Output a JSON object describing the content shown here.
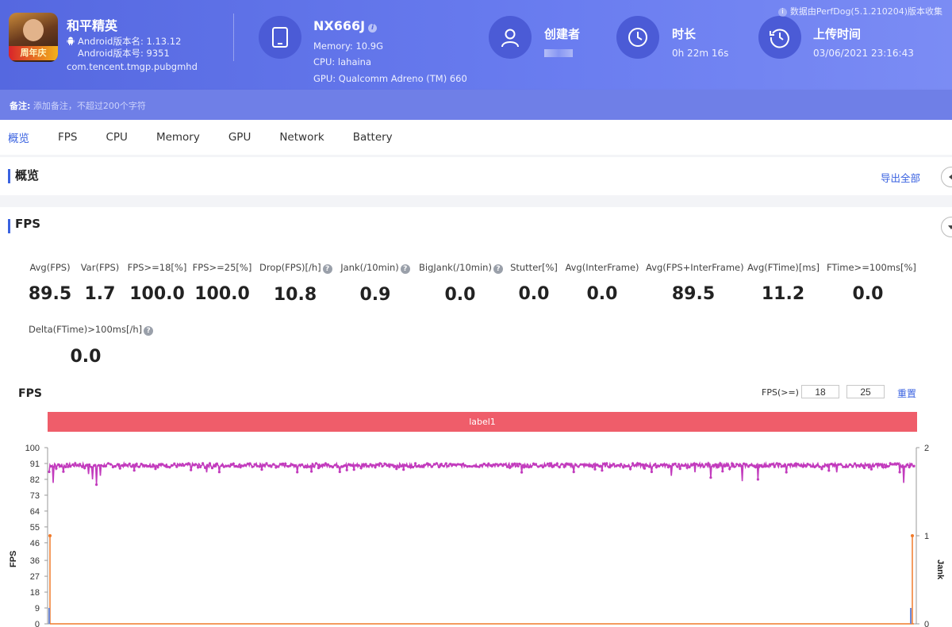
{
  "header": {
    "app_name": "和平精英",
    "app_icon_badge": "周年庆",
    "android_version_name": "Android版本名: 1.13.12",
    "android_version_code": "Android版本号: 9351",
    "package": "com.tencent.tmgp.pubgmhd",
    "device_name": "NX666J",
    "memory": "Memory: 10.9G",
    "cpu": "CPU: lahaina",
    "gpu": "GPU: Qualcomm Adreno (TM) 660",
    "creator_label": "创建者",
    "duration_label": "时长",
    "duration_value": "0h 22m 16s",
    "upload_label": "上传时间",
    "upload_value": "03/06/2021 23:16:43",
    "source_note": "数据由PerfDog(5.1.210204)版本收集"
  },
  "remark": {
    "label": "备注:",
    "placeholder": "添加备注，不超过200个字符"
  },
  "tabs": [
    "概览",
    "FPS",
    "CPU",
    "Memory",
    "GPU",
    "Network",
    "Battery"
  ],
  "overview": {
    "title": "概览",
    "export_label": "导出全部"
  },
  "fps_section": {
    "title": "FPS",
    "metrics": [
      {
        "label": "Avg(FPS)",
        "value": "89.5"
      },
      {
        "label": "Var(FPS)",
        "value": "1.7"
      },
      {
        "label": "FPS>=18[%]",
        "value": "100.0"
      },
      {
        "label": "FPS>=25[%]",
        "value": "100.0"
      },
      {
        "label": "Drop(FPS)[/h]",
        "value": "10.8"
      },
      {
        "label": "Jank(/10min)",
        "value": "0.9"
      },
      {
        "label": "BigJank(/10min)",
        "value": "0.0"
      },
      {
        "label": "Stutter[%]",
        "value": "0.0"
      },
      {
        "label": "Avg(InterFrame)",
        "value": "0.0"
      },
      {
        "label": "Avg(FPS+InterFrame)",
        "value": "89.5"
      },
      {
        "label": "Avg(FTime)[ms]",
        "value": "11.2"
      },
      {
        "label": "FTime>=100ms[%]",
        "value": "0.0"
      },
      {
        "label": "Delta(FTime)>100ms[/h]",
        "value": "0.0"
      }
    ],
    "chart_title": "FPS",
    "threshold_label": "FPS(>=)",
    "threshold_1": "18",
    "threshold_2": "25",
    "reset_label": "重置",
    "band_label": "label1"
  },
  "chart_data": {
    "type": "line",
    "title": "FPS",
    "ylabel": "FPS",
    "y2label": "Jank",
    "ylim": [
      0,
      100
    ],
    "y2lim": [
      0,
      2
    ],
    "yticks": [
      0,
      9,
      18,
      27,
      36,
      46,
      55,
      64,
      73,
      82,
      91,
      100
    ],
    "y2ticks": [
      0,
      1,
      2
    ],
    "series": [
      {
        "name": "FPS",
        "color": "#c23bbd",
        "baseline": 90,
        "dips": [
          [
            5,
            80
          ],
          [
            50,
            85
          ],
          [
            55,
            82
          ],
          [
            60,
            79
          ],
          [
            65,
            84
          ],
          [
            200,
            86
          ],
          [
            450,
            85
          ],
          [
            600,
            86
          ],
          [
            790,
            84
          ],
          [
            820,
            86
          ],
          [
            840,
            83
          ],
          [
            880,
            81
          ],
          [
            900,
            82
          ],
          [
            1000,
            86
          ],
          [
            1080,
            84
          ],
          [
            1085,
            80
          ]
        ]
      },
      {
        "name": "Jank",
        "color": "#f07a2a",
        "values_at_edges": [
          1,
          1
        ]
      }
    ],
    "colors": {
      "fps_line": "#c23bbd",
      "jank_line": "#f07a2a",
      "band": "#ef5d6a",
      "accent": "#3a62e0"
    }
  }
}
